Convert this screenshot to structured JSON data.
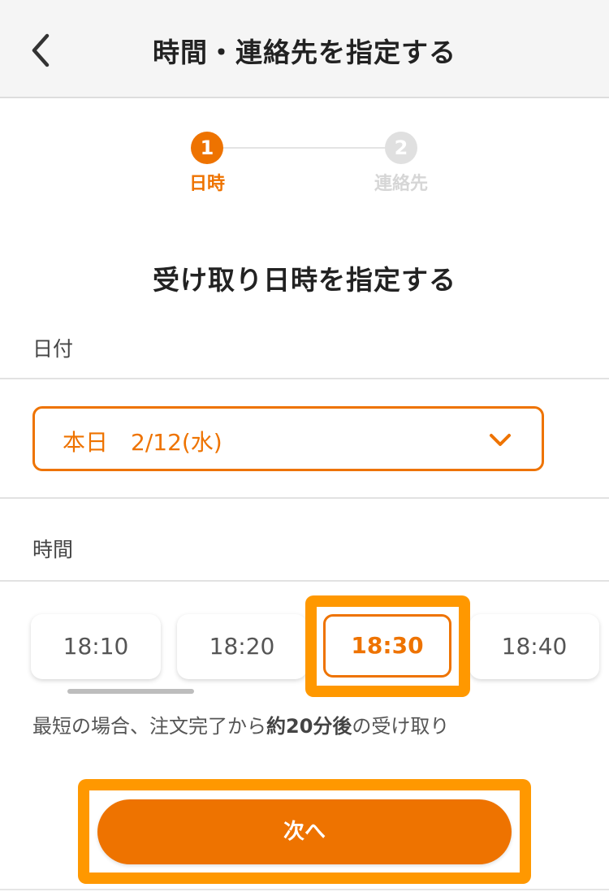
{
  "header": {
    "title": "時間・連絡先を指定する",
    "back_icon": "chevron-left-icon"
  },
  "stepper": {
    "current_step": 1,
    "steps": [
      {
        "number": "1",
        "label": "日時",
        "active": true
      },
      {
        "number": "2",
        "label": "連絡先",
        "active": false
      }
    ]
  },
  "section_title": "受け取り日時を指定する",
  "date": {
    "label": "日付",
    "selected_value": "本日　2/12(水)",
    "icon": "chevron-down-icon"
  },
  "time": {
    "label": "時間",
    "slots": [
      {
        "value": "18:10",
        "selected": false
      },
      {
        "value": "18:20",
        "selected": false
      },
      {
        "value": "18:30",
        "selected": true
      },
      {
        "value": "18:40",
        "selected": false
      }
    ],
    "scroll_position": 0.0
  },
  "note": {
    "prefix": "最短の場合、注文完了から",
    "emphasis": "約20分後",
    "suffix": "の受け取り"
  },
  "next_button": {
    "label": "次へ"
  },
  "colors": {
    "accent": "#ee7300",
    "highlight": "#ff9800",
    "inactive_step": "#e0e0e0",
    "header_bg": "#f5f5f5"
  }
}
